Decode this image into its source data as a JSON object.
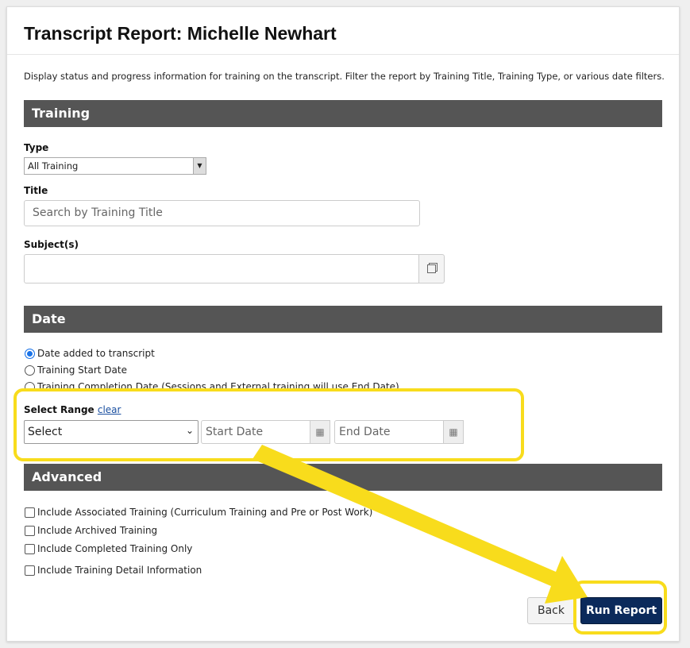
{
  "title": "Transcript Report: Michelle Newhart",
  "description": "Display status and progress information for training on the transcript. Filter the report by Training Title, Training Type, or various date filters.",
  "training": {
    "heading": "Training",
    "type_label": "Type",
    "type_value": "All Training",
    "title_label": "Title",
    "title_placeholder": "Search by Training Title",
    "subjects_label": "Subject(s)"
  },
  "date": {
    "heading": "Date",
    "options": [
      "Date added to transcript",
      "Training Start Date",
      "Training Completion Date (Sessions and External training will use End Date)"
    ],
    "selected": 0,
    "range_label": "Select Range",
    "clear_link": "clear",
    "range_value": "Select",
    "start_placeholder": "Start Date",
    "end_placeholder": "End Date"
  },
  "advanced": {
    "heading": "Advanced",
    "options": [
      "Include Associated Training (Curriculum Training and Pre or Post Work)",
      "Include Archived Training",
      "Include Completed Training Only",
      "Include Training Detail Information"
    ]
  },
  "buttons": {
    "back": "Back",
    "run": "Run Report"
  },
  "colors": {
    "highlight": "#f8dc1c",
    "primary": "#0b2a5b",
    "section": "#555555"
  }
}
